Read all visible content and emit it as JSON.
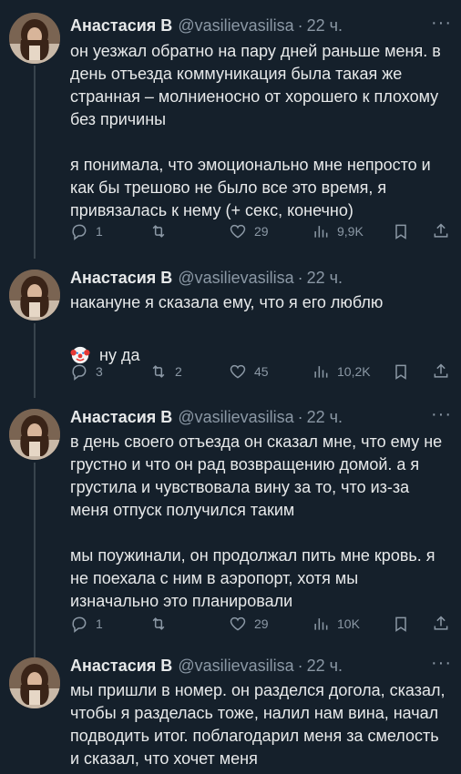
{
  "author": {
    "name": "Анастасия В",
    "handle": "@vasilievasilisa",
    "separator": "·",
    "time": "22 ч."
  },
  "more_label": "···",
  "tweets": [
    {
      "paragraphs": [
        "он уезжал обратно на пару дней раньше меня. в день отъезда коммуникация была такая же странная – молниеносно от хорошего к плохому без причины",
        "я понимала, что эмоционально мне непросто и как бы трешово не было все это время, я привязалась к нему (+ секс, конечно)"
      ],
      "replies": "1",
      "retweets": "",
      "likes": "29",
      "views": "9,9K"
    },
    {
      "paragraphs": [
        "накануне я сказала ему, что я его люблю",
        "ну да"
      ],
      "emoji_icon": "clown-face-icon",
      "replies": "3",
      "retweets": "2",
      "likes": "45",
      "views": "10,2K"
    },
    {
      "paragraphs": [
        "в день своего отъезда он сказал мне, что ему не грустно и что он рад возвращению домой. а я грустила и чувствовала вину за то, что из-за меня отпуск получился таким",
        "мы поужинали, он продолжал пить мне кровь. я не поехала с ним в аэропорт, хотя мы изначально это планировали"
      ],
      "replies": "1",
      "retweets": "",
      "likes": "29",
      "views": "10K"
    },
    {
      "paragraphs": [
        "мы пришли в номер. он разделся догола, сказал, чтобы я разделась тоже, налил нам вина, начал подводить итог. поблагодарил меня за смелость и сказал, что хочет меня"
      ]
    }
  ]
}
